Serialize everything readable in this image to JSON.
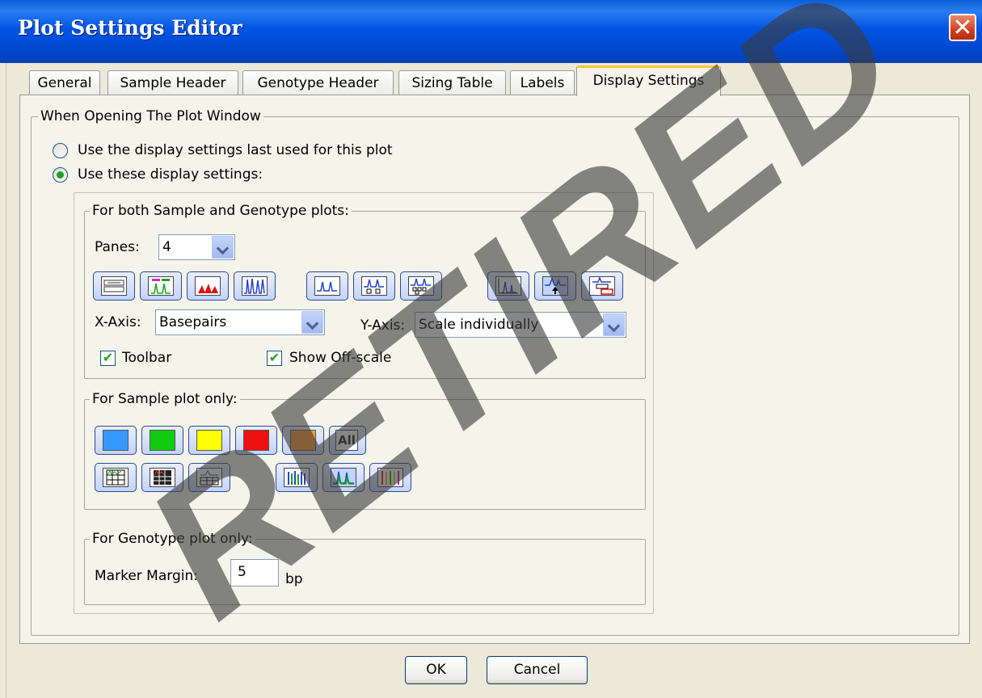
{
  "window": {
    "title": "Plot Settings Editor",
    "close_glyph": "✕"
  },
  "tabs": [
    {
      "label": "General"
    },
    {
      "label": "Sample Header"
    },
    {
      "label": "Genotype Header"
    },
    {
      "label": "Sizing Table"
    },
    {
      "label": "Labels"
    },
    {
      "label": "Display Settings",
      "active": true
    }
  ],
  "opening": {
    "group_label": "When Opening The Plot Window",
    "option_last": "Use the display settings last used for this plot",
    "option_these": "Use these display settings:",
    "selected": "option_these"
  },
  "both_plots": {
    "group_label": "For both Sample and Genotype plots:",
    "panes_label": "Panes:",
    "panes_value": "4",
    "xaxis_label": "X-Axis:",
    "xaxis_value": "Basepairs",
    "yaxis_label": "Y-Axis:",
    "yaxis_value": "Scale individually",
    "toolbar_label": "Toolbar",
    "toolbar_checked": true,
    "offscale_label": "Show Off-scale",
    "offscale_checked": true,
    "icons": [
      "table-view-icon",
      "header-markers-icon",
      "red-peaks-icon",
      "blue-peaks-icon",
      "single-peak-icon",
      "labeled-peaks-icon",
      "multi-label-peaks-icon",
      "axis-peak-icon",
      "arrow-peak-icon",
      "stacked-panels-icon"
    ]
  },
  "sample_only": {
    "group_label": "For Sample plot only:",
    "colors": [
      "#3399ff",
      "#11cc11",
      "#ffff00",
      "#ee1111",
      "#ff9933"
    ],
    "all_label": "All"
  },
  "genotype_only": {
    "group_label": "For Genotype plot only:",
    "margin_label": "Marker Margin:",
    "margin_value": "5",
    "margin_unit": "bp"
  },
  "footer": {
    "ok_label": "OK",
    "cancel_label": "Cancel"
  },
  "watermark": "RETIRED"
}
